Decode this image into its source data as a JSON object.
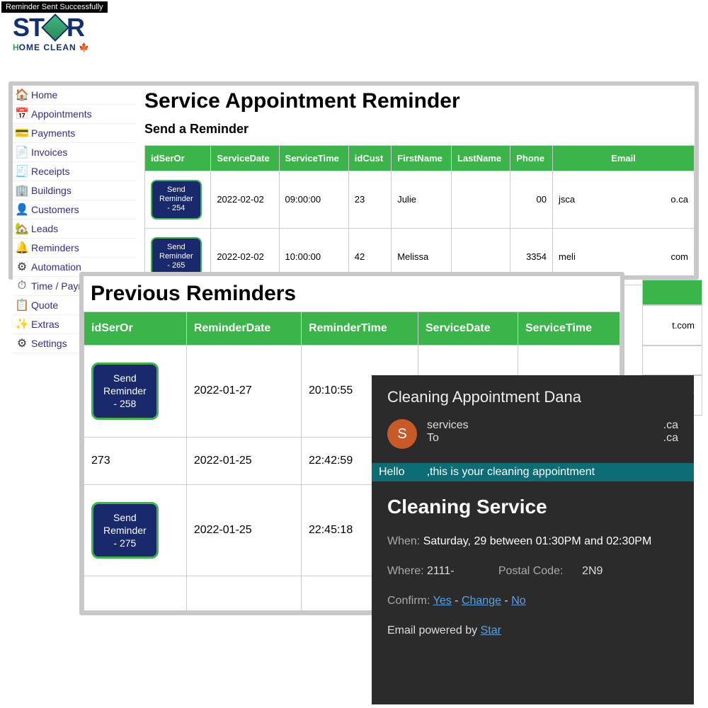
{
  "toast": "Reminder Sent Successfully",
  "logo": {
    "text1": "ST",
    "text2": "R",
    "sub_h": "H",
    "sub_rest": "OME CLEAN",
    "leaf": "🍁"
  },
  "sidebar": {
    "items": [
      {
        "label": "Home",
        "icon": "🏠"
      },
      {
        "label": "Appointments",
        "icon": "📅"
      },
      {
        "label": "Payments",
        "icon": "💳"
      },
      {
        "label": "Invoices",
        "icon": "📄"
      },
      {
        "label": "Receipts",
        "icon": "🧾"
      },
      {
        "label": "Buildings",
        "icon": "🏢"
      },
      {
        "label": "Customers",
        "icon": "👤"
      },
      {
        "label": "Leads",
        "icon": "🏡"
      },
      {
        "label": "Reminders",
        "icon": "🔔"
      },
      {
        "label": "Automation",
        "icon": "⚙"
      },
      {
        "label": "Time / Paymer",
        "icon": "⏱"
      },
      {
        "label": "Quote",
        "icon": "📋"
      },
      {
        "label": "Extras",
        "icon": "✨"
      },
      {
        "label": "Settings",
        "icon": "⚙"
      }
    ]
  },
  "main": {
    "title": "Service Appointment Reminder",
    "subtitle": "Send a Reminder",
    "headers": [
      "idSerOr",
      "ServiceDate",
      "ServiceTime",
      "idCust",
      "FirstName",
      "LastName",
      "Phone",
      "Email"
    ],
    "rows": [
      {
        "btn_l1": "Send",
        "btn_l2": "Reminder",
        "btn_l3": "- 254",
        "date": "2022-02-02",
        "time": "09:00:00",
        "idcust": "23",
        "first": "Julie",
        "last": "",
        "phone": "00",
        "email_a": "jsca",
        "email_b": "o.ca"
      },
      {
        "btn_l1": "Send",
        "btn_l2": "Reminder",
        "btn_l3": "- 265",
        "date": "2022-02-02",
        "time": "10:00:00",
        "idcust": "42",
        "first": "Melissa",
        "last": "",
        "phone": "3354",
        "email_a": "meli",
        "email_b": "com"
      }
    ]
  },
  "previous": {
    "title": "Previous Reminders",
    "headers": [
      "idSerOr",
      "ReminderDate",
      "ReminderTime",
      "ServiceDate",
      "ServiceTime"
    ],
    "rows": [
      {
        "btn_l1": "Send",
        "btn_l2": "Reminder",
        "btn_l3": "- 258",
        "rdate": "2022-01-27",
        "rtime": "20:10:55",
        "sdate": "",
        "stime": ""
      },
      {
        "id": "273",
        "rdate": "2022-01-25",
        "rtime": "22:42:59",
        "sdate": "",
        "stime": ""
      },
      {
        "btn_l1": "Send",
        "btn_l2": "Reminder",
        "btn_l3": "- 275",
        "rdate": "2022-01-25",
        "rtime": "22:45:18",
        "sdate": "",
        "stime": ""
      }
    ]
  },
  "ghost": {
    "c1": "t.com",
    "c2": "com"
  },
  "email": {
    "subject": "Cleaning Appointment Dana",
    "avatar": "S",
    "from": "services",
    "from_dom": ".ca",
    "to_lbl": "To",
    "to_dom": ".ca",
    "hello_a": "Hello",
    "hello_b": ",this is your cleaning appointment",
    "cs": "Cleaning Service",
    "when_lbl": "When:",
    "when_val": "Saturday, 29 between 01:30PM and 02:30PM",
    "where_lbl": "Where:",
    "where_val": "2111-",
    "postal_lbl": "Postal Code:",
    "postal_val": "2N9",
    "confirm_lbl": "Confirm:",
    "yes": "Yes",
    "sep": " - ",
    "change": "Change",
    "no": "No",
    "foot": "Email powered by ",
    "foot_link": "Star"
  }
}
